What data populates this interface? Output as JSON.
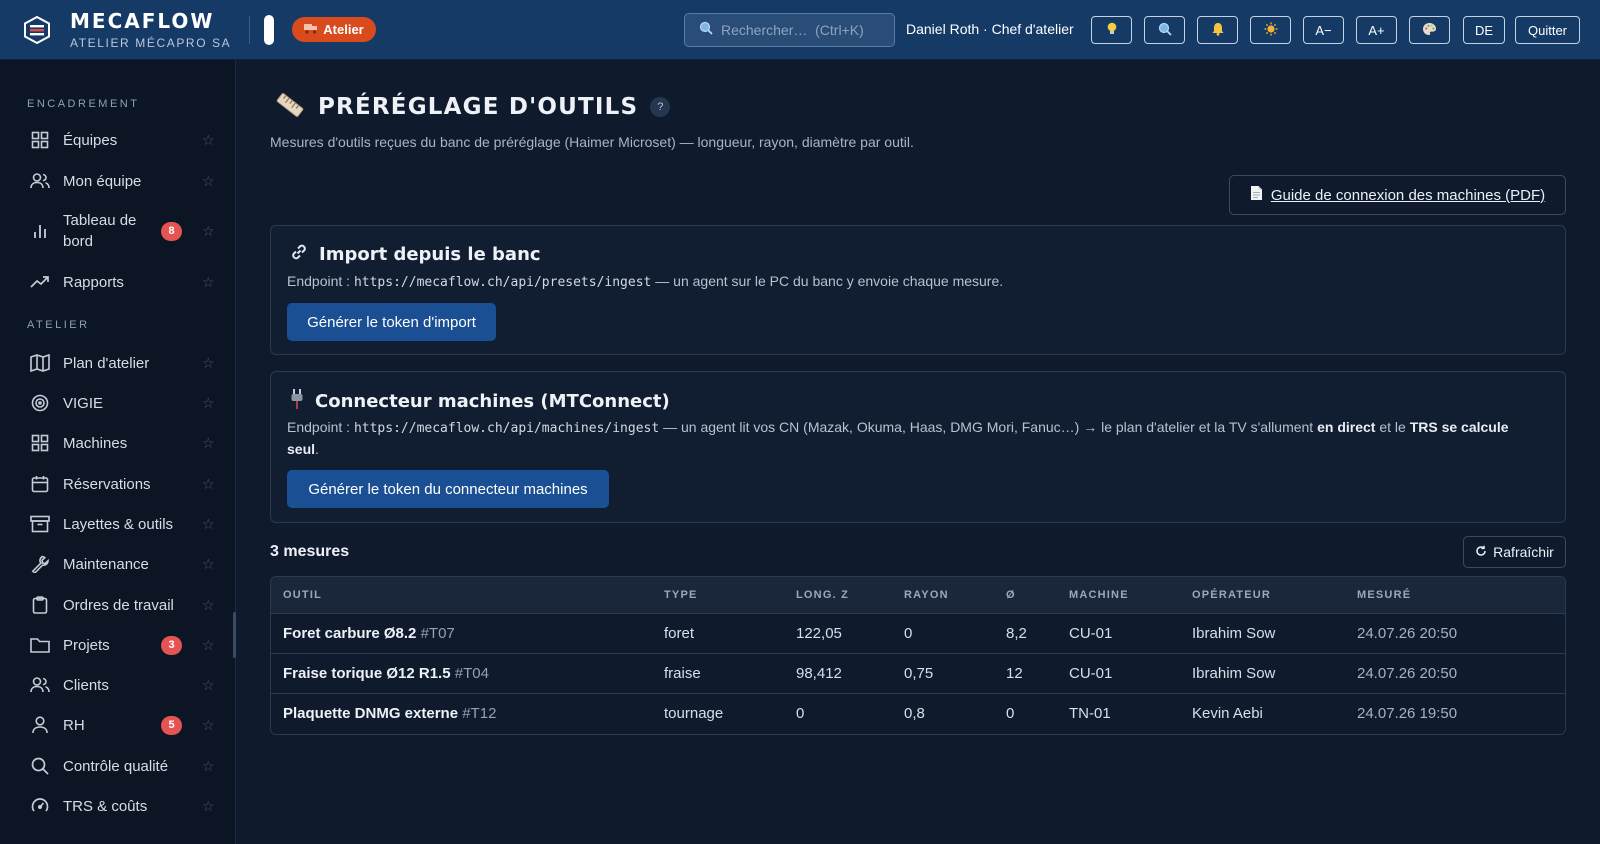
{
  "header": {
    "brand_name": "MECAFLOW",
    "brand_sub": "ATELIER MÉCAPRO SA",
    "workspace_badge": "Atelier",
    "search_placeholder": "Rechercher…  (Ctrl+K)",
    "user": "Daniel Roth · Chef d'atelier",
    "btn_ideas_icon": "lightbulb-icon",
    "btn_search_icon": "magnifier-icon",
    "btn_notif_icon": "bell-icon",
    "btn_theme_icon": "sun-icon",
    "font_smaller": "A−",
    "font_larger": "A+",
    "btn_palette_icon": "palette-icon",
    "lang": "DE",
    "quit": "Quitter"
  },
  "sidebar": {
    "section_1": "ENCADREMENT",
    "section_2": "ATELIER",
    "items": [
      {
        "label": "Équipes",
        "icon": "grid-icon"
      },
      {
        "label": "Mon équipe",
        "icon": "users-icon"
      },
      {
        "label": "Tableau de bord",
        "icon": "bar-chart-icon",
        "badge": "8"
      },
      {
        "label": "Rapports",
        "icon": "trending-icon"
      },
      {
        "label": "Plan d'atelier",
        "icon": "map-icon"
      },
      {
        "label": "VIGIE",
        "icon": "target-icon"
      },
      {
        "label": "Machines",
        "icon": "grid-icon"
      },
      {
        "label": "Réservations",
        "icon": "calendar-icon"
      },
      {
        "label": "Layettes & outils",
        "icon": "archive-icon"
      },
      {
        "label": "Maintenance",
        "icon": "wrench-icon"
      },
      {
        "label": "Ordres de travail",
        "icon": "clipboard-icon"
      },
      {
        "label": "Projets",
        "icon": "folder-icon",
        "badge": "3"
      },
      {
        "label": "Clients",
        "icon": "users-icon"
      },
      {
        "label": "RH",
        "icon": "user-icon",
        "badge": "5"
      },
      {
        "label": "Contrôle qualité",
        "icon": "search-icon"
      },
      {
        "label": "TRS & coûts",
        "icon": "gauge-icon"
      }
    ]
  },
  "page": {
    "title": "PRÉRÉGLAGE D'OUTILS",
    "help": "?",
    "subtitle": "Mesures d'outils reçues du banc de préréglage (Haimer Microset) — longueur, rayon, diamètre par outil.",
    "guide_button": "Guide de connexion des machines (PDF)"
  },
  "import_card": {
    "title": "Import depuis le banc",
    "endpoint_label": "Endpoint :",
    "endpoint": "https://mecaflow.ch/api/presets/ingest",
    "text": "— un agent sur le PC du banc y envoie chaque mesure.",
    "button": "Générer le token d'import"
  },
  "machines_card": {
    "title": "Connecteur machines (MTConnect)",
    "endpoint_label": "Endpoint :",
    "endpoint": "https://mecaflow.ch/api/machines/ingest",
    "text_1": "— un agent lit vos CN (Mazak, Okuma, Haas, DMG Mori, Fanuc…) → le plan d'atelier et la TV s'allument",
    "bold_1": "en direct",
    "text_2": "et le",
    "bold_2": "TRS se calcule seul",
    "text_3": ".",
    "button": "Générer le token du connecteur machines"
  },
  "measures": {
    "count": "3 mesures",
    "refresh": "Rafraîchir",
    "columns": [
      "OUTIL",
      "TYPE",
      "LONG. Z",
      "RAYON",
      "Ø",
      "MACHINE",
      "OPÉRATEUR",
      "MESURÉ"
    ],
    "rows": [
      {
        "name": "Foret carbure Ø8.2",
        "code": "#T07",
        "type": "foret",
        "z": "122,05",
        "radius": "0",
        "diam": "8,2",
        "machine": "CU-01",
        "operator": "Ibrahim Sow",
        "measured": "24.07.26 20:50"
      },
      {
        "name": "Fraise torique Ø12 R1.5",
        "code": "#T04",
        "type": "fraise",
        "z": "98,412",
        "radius": "0,75",
        "diam": "12",
        "machine": "CU-01",
        "operator": "Ibrahim Sow",
        "measured": "24.07.26 20:50"
      },
      {
        "name": "Plaquette DNMG externe",
        "code": "#T12",
        "type": "tournage",
        "z": "0",
        "radius": "0,8",
        "diam": "0",
        "machine": "TN-01",
        "operator": "Kevin Aebi",
        "measured": "24.07.26 19:50"
      }
    ]
  }
}
